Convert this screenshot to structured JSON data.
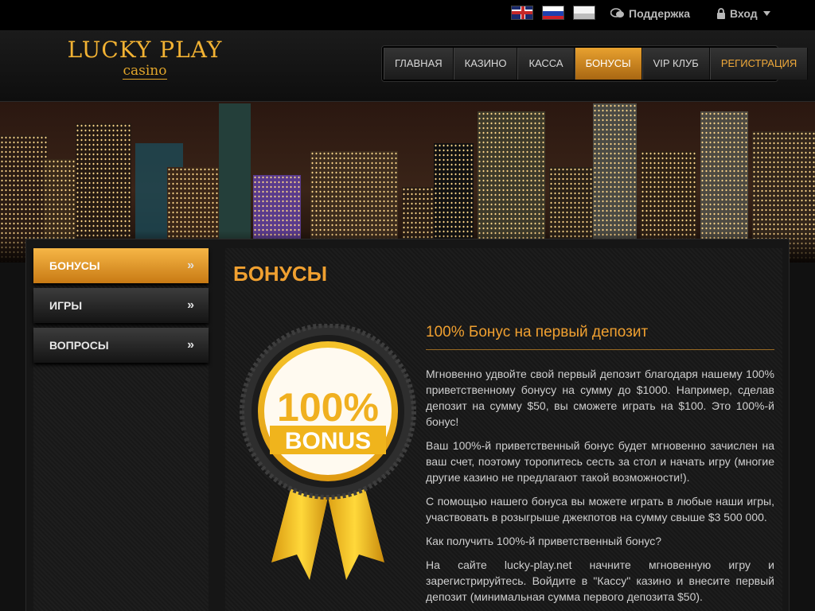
{
  "topbar": {
    "languages": [
      "english-flag",
      "russian-flag",
      "other-language-flag"
    ],
    "support_label": "Поддержка",
    "login_label": "Вход"
  },
  "logo": {
    "main": "LUCKY PLAY",
    "sub": "casino"
  },
  "nav": {
    "items": [
      {
        "label": "ГЛАВНАЯ"
      },
      {
        "label": "КАЗИНО"
      },
      {
        "label": "КАССА"
      },
      {
        "label": "БОНУСЫ",
        "active": true
      },
      {
        "label": "VIP КЛУБ"
      },
      {
        "label": "РЕГИСТРАЦИЯ"
      }
    ]
  },
  "sidebar": {
    "items": [
      {
        "label": "БОНУСЫ",
        "active": true
      },
      {
        "label": "ИГРЫ"
      },
      {
        "label": "ВОПРОСЫ"
      }
    ]
  },
  "page": {
    "title": "БОНУСЫ"
  },
  "badge": {
    "percent": "100%",
    "word": "BONUS"
  },
  "article": {
    "title": "100% Бонус на первый депозит",
    "paragraphs": [
      "Мгновенно удвойте свой первый депозит благодаря нашему 100% приветственному бонусу на сумму до $1000. Например, сделав депозит на сумму $50, вы сможете играть на $100. Это 100%-й бонус!",
      "Ваш 100%-й приветственный бонус будет мгновенно зачислен на ваш счет, поэтому торопитесь сесть за стол и начать игру (многие другие казино не предлагают такой возможности!).",
      "С помощью нашего бонуса вы можете играть в любые наши игры, участвовать в розыгрыше джекпотов на сумму свыше $3 500 000.",
      "Как получить 100%-й приветственный бонус?",
      "На сайте lucky-play.net начните мгновенную игру и зарегистрируйтесь. Войдите в \"Кассу\" казино и внесите первый депозит (минимальная сумма первого депозита $50)."
    ]
  },
  "colors": {
    "accent": "#f0a030",
    "background": "#111111"
  }
}
